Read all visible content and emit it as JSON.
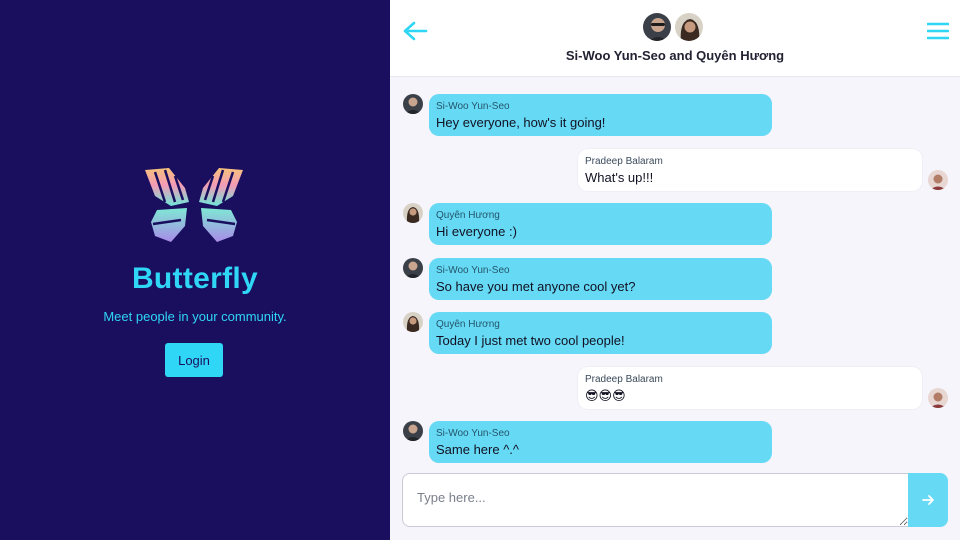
{
  "brand": {
    "title": "Butterfly",
    "tagline": "Meet people in your community.",
    "login_label": "Login",
    "logo_icon": "butterfly-logo-icon"
  },
  "header": {
    "title": "Si-Woo Yun-Seo and Quyên Hương",
    "back_icon": "arrow-left-icon",
    "menu_icon": "hamburger-menu-icon"
  },
  "messages": [
    {
      "sender": "Si-Woo Yun-Seo",
      "text": "Hey everyone, how's it going!",
      "direction": "in"
    },
    {
      "sender": "Pradeep Balaram",
      "text": "What's up!!!",
      "direction": "out"
    },
    {
      "sender": "Quyên Hương",
      "text": "Hi everyone :)",
      "direction": "in"
    },
    {
      "sender": "Si-Woo Yun-Seo",
      "text": "So have you met anyone cool yet?",
      "direction": "in"
    },
    {
      "sender": "Quyên Hương",
      "text": "Today I just met two cool people!",
      "direction": "in"
    },
    {
      "sender": "Pradeep Balaram",
      "text": "😎😎😎",
      "direction": "out"
    },
    {
      "sender": "Si-Woo Yun-Seo",
      "text": "Same here ^.^",
      "direction": "in"
    }
  ],
  "composer": {
    "placeholder": "Type here...",
    "value": "",
    "send_icon": "send-arrow-icon"
  },
  "colors": {
    "brand_bg": "#1a0f5e",
    "accent": "#2fd6f5",
    "bubble_in": "#66d9f5",
    "bubble_out": "#ffffff",
    "chat_bg": "#f5f5fb"
  }
}
